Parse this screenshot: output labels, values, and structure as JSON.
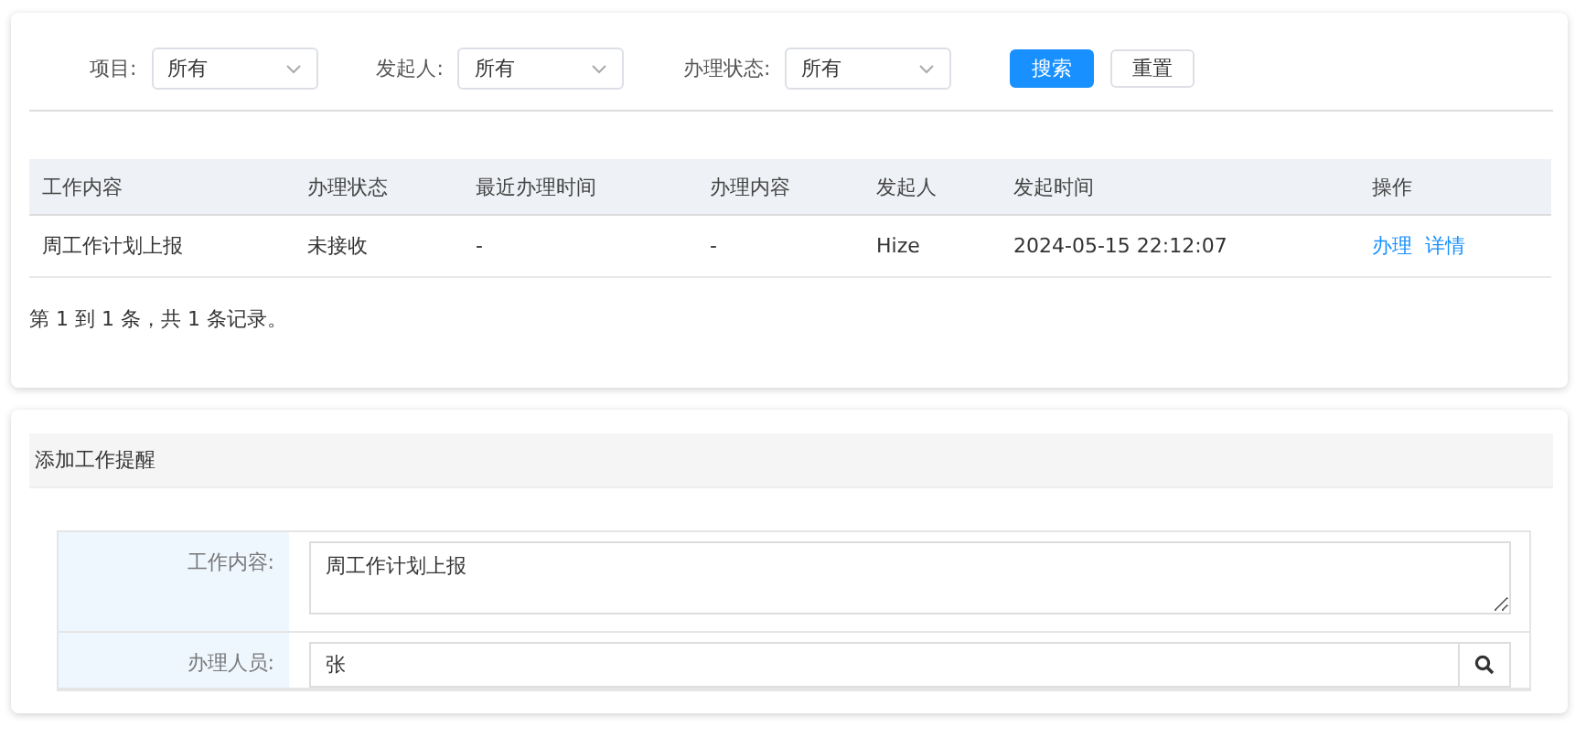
{
  "filters": [
    {
      "label": "项目:",
      "value": "所有"
    },
    {
      "label": "发起人:",
      "value": "所有"
    },
    {
      "label": "办理状态:",
      "value": "所有"
    }
  ],
  "buttons": [
    {
      "label": "搜索",
      "kind": "primary"
    },
    {
      "label": "重置",
      "kind": "default"
    }
  ],
  "table": {
    "columns": [
      "工作内容",
      "办理状态",
      "最近办理时间",
      "办理内容",
      "发起人",
      "发起时间",
      "操作"
    ],
    "rows": [
      {
        "cells": [
          "周工作计划上报",
          "未接收",
          "-",
          "-",
          "Hize",
          "2024-05-15 22:12:07"
        ],
        "actions": [
          "办理",
          "详情"
        ]
      }
    ]
  },
  "pagination": "第 1 到 1 条，共 1 条记录。",
  "form": {
    "title": "添加工作提醒",
    "fields": [
      {
        "label": "工作内容:",
        "kind": "textarea",
        "value": "周工作计划上报"
      },
      {
        "label": "办理人员:",
        "kind": "search",
        "value": "张"
      }
    ]
  }
}
